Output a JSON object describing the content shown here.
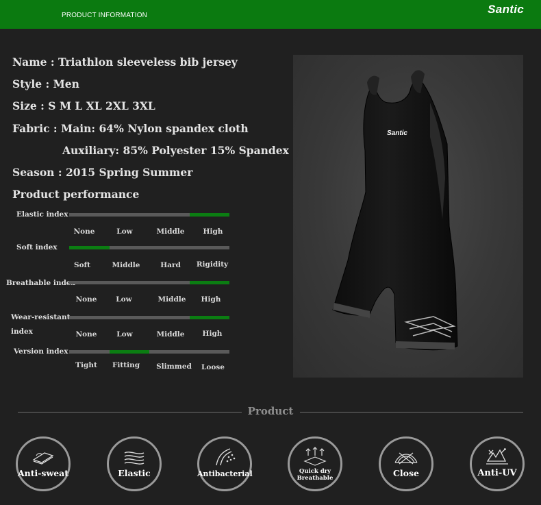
{
  "header": {
    "title": "PRODUCT INFORMATION",
    "brand": "Santic"
  },
  "specs": {
    "name": "Name : Triathlon sleeveless bib jersey",
    "style": "Style : Men",
    "size": "Size : S M L XL 2XL 3XL",
    "fabric_main": "Fabric :  Main: 64% Nylon spandex cloth",
    "fabric_aux": "Auxiliary: 85% Polyester 15% Spandex",
    "season": "Season : 2015 Spring Summer",
    "performance_title": "Product performance"
  },
  "performance": [
    {
      "label": "Elastic index",
      "ticks": [
        "None",
        "Low",
        "Middle",
        "High"
      ],
      "level": 4,
      "colors": {
        "track": "#5a5a5a",
        "fill": "#0b7d12"
      }
    },
    {
      "label": "Soft index",
      "ticks": [
        "Soft",
        "Middle",
        "Hard",
        "Rigidity"
      ],
      "level": 1
    },
    {
      "label": "Breathable index",
      "ticks": [
        "None",
        "Low",
        "Middle",
        "High"
      ],
      "level": 4
    },
    {
      "label": "Wear-resistant",
      "label_line2": "index",
      "ticks": [
        "None",
        "Low",
        "Middle",
        "High"
      ],
      "level": 4
    },
    {
      "label": "Version index",
      "ticks": [
        "Tight",
        "Fitting",
        "Slimmed",
        "Loose"
      ],
      "level": 2
    }
  ],
  "product_photo": {
    "chest_logo": "Santic"
  },
  "features_section": {
    "title": "Product"
  },
  "features": [
    {
      "label": "Anti-sweat",
      "icon": "anti-sweat-icon"
    },
    {
      "label": "Elastic",
      "icon": "elastic-icon"
    },
    {
      "label": "Antibacterial",
      "icon": "antibacterial-icon"
    },
    {
      "label_line1": "Quick dry",
      "label_line2": "Breathable",
      "icon": "quick-dry-icon"
    },
    {
      "label": "Close",
      "icon": "close-fit-icon"
    },
    {
      "label": "Anti-UV",
      "icon": "anti-uv-icon"
    }
  ],
  "colors": {
    "header_green": "#0b7a10",
    "background": "#202020",
    "bar_fill": "#0b7d12",
    "bar_track": "#5a5a5a"
  }
}
